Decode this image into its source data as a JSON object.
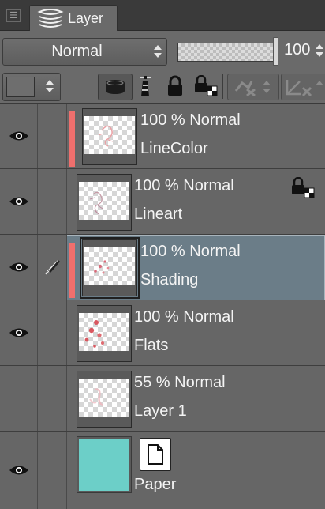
{
  "panel": {
    "tab_label": "Layer",
    "tab_icon": "layer-stack-icon"
  },
  "toolbar": {
    "blend_mode": "Normal",
    "opacity_value": "100",
    "opacity_fraction": 1.0,
    "layer_color_swatch": "#6e6e6e"
  },
  "layers": [
    {
      "opacity_mode": "100 % Normal",
      "name": "LineColor",
      "visible": true,
      "color_bar": true,
      "locked": false,
      "selected": false
    },
    {
      "opacity_mode": "100 % Normal",
      "name": "Lineart",
      "visible": true,
      "color_bar": false,
      "locked": true,
      "selected": false
    },
    {
      "opacity_mode": "100 % Normal",
      "name": "Shading",
      "visible": true,
      "color_bar": true,
      "locked": false,
      "selected": true,
      "active_tool_icon": "pen-icon"
    },
    {
      "opacity_mode": "100 % Normal",
      "name": "Flats",
      "visible": true,
      "color_bar": false,
      "locked": false,
      "selected": false
    },
    {
      "opacity_mode": "55 % Normal",
      "name": "Layer 1",
      "visible": false,
      "color_bar": false,
      "locked": false,
      "selected": false
    },
    {
      "name": "Paper",
      "visible": true,
      "color": "#6ccfc8",
      "is_paper": true
    }
  ],
  "colors": {
    "color_bar": "#ef6f6d",
    "selected_row": "#6b7d88",
    "paper_color": "#6ccfc8"
  }
}
